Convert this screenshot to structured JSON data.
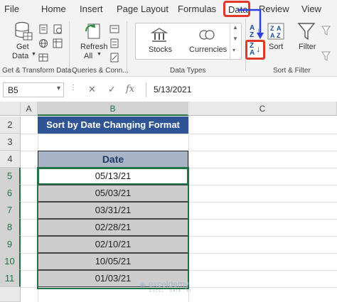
{
  "tabs": [
    "File",
    "Home",
    "Insert",
    "Page Layout",
    "Formulas",
    "Data",
    "Review",
    "View"
  ],
  "ribbon": {
    "get_data": "Get\nData",
    "get_data_line1": "Get",
    "get_data_line2": "Data",
    "refresh_line1": "Refresh",
    "refresh_line2": "All",
    "stocks": "Stocks",
    "currencies": "Currencies",
    "sort": "Sort",
    "filter": "Filter",
    "sort_az_top": "A",
    "sort_az_bottom": "Z",
    "sort_za_top": "Z",
    "sort_za_bottom": "A",
    "groups": {
      "get_transform": "Get & Transform Data",
      "queries": "Queries & Conn...",
      "data_types": "Data Types",
      "sort_filter": "Sort & Filter"
    }
  },
  "formula_bar": {
    "name_box": "B5",
    "value": "5/13/2021",
    "cancel_icon": "✕",
    "enter_icon": "✓",
    "fx": "fx"
  },
  "grid": {
    "columns": [
      "A",
      "B",
      "C"
    ],
    "rows": [
      "2",
      "3",
      "4",
      "5",
      "6",
      "7",
      "8",
      "9",
      "10",
      "11"
    ],
    "title": "Sort by Date Changing Format",
    "date_header": "Date",
    "dates": [
      "05/13/21",
      "05/03/21",
      "03/31/21",
      "02/28/21",
      "02/10/21",
      "10/05/21",
      "01/03/21"
    ],
    "selected_cell": "B5"
  },
  "watermark": {
    "name": "exceldemy",
    "tagline": "EXCEL · DATA · BI"
  },
  "colors": {
    "excel_green": "#217346",
    "highlight_red": "#e0382b",
    "title_fill": "#2f5496",
    "arrow_blue": "#2d3fe0"
  }
}
